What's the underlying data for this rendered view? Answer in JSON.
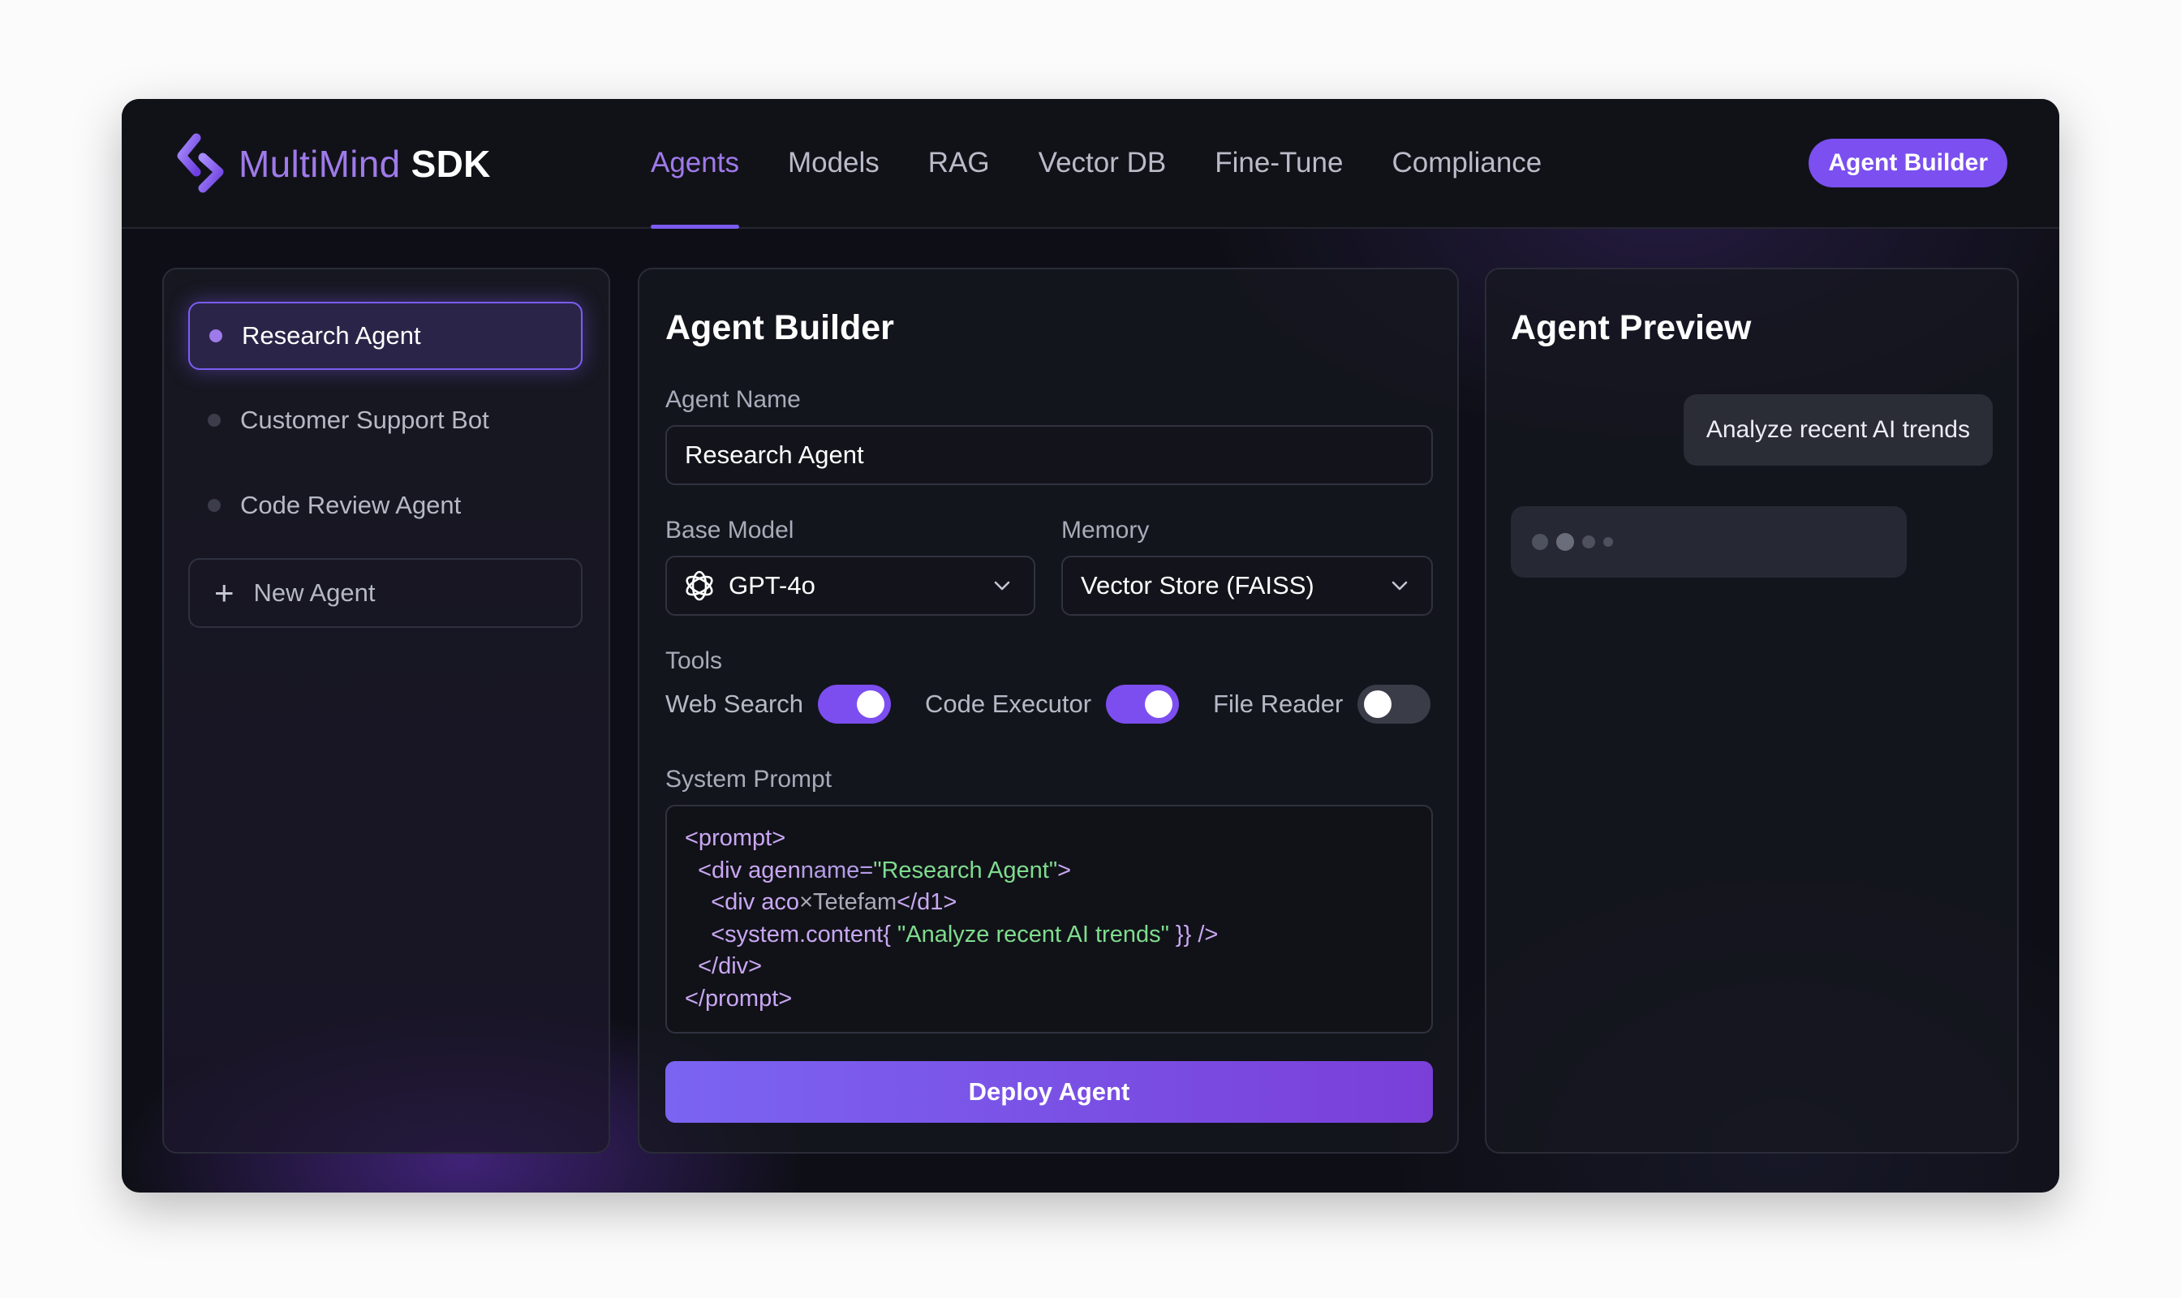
{
  "app": {
    "logo_primary": "MultiMind",
    "logo_secondary": "SDK",
    "accent_color": "#7c4ef0"
  },
  "nav": {
    "items": [
      {
        "label": "Agents",
        "active": true
      },
      {
        "label": "Models",
        "active": false
      },
      {
        "label": "RAG",
        "active": false
      },
      {
        "label": "Vector DB",
        "active": false
      },
      {
        "label": "Fine-Tune",
        "active": false
      },
      {
        "label": "Compliance",
        "active": false
      }
    ],
    "cta_label": "Agent Builder"
  },
  "sidebar": {
    "agents": [
      {
        "label": "Research Agent",
        "active": true
      },
      {
        "label": "Customer Support Bot",
        "active": false
      },
      {
        "label": "Code Review Agent",
        "active": false
      }
    ],
    "new_agent_label": "New Agent"
  },
  "builder": {
    "title": "Agent Builder",
    "agent_name_label": "Agent Name",
    "agent_name_value": "Research Agent",
    "base_model_label": "Base Model",
    "base_model_value": "GPT-4o",
    "base_model_icon": "openai-icon",
    "memory_label": "Memory",
    "memory_value": "Vector Store (FAISS)",
    "tools_label": "Tools",
    "tools": [
      {
        "label": "Web Search",
        "enabled": true
      },
      {
        "label": "Code Executor",
        "enabled": true
      },
      {
        "label": "File Reader",
        "enabled": false
      }
    ],
    "system_prompt_label": "System Prompt",
    "system_prompt_lines": {
      "l1": "<prompt>",
      "l2a": "  <div agen",
      "l2b": "name=",
      "l2c": "\"Research Agent\"",
      "l2d": ">",
      "l3a": "    <div aco",
      "l3b": "×Tetefam",
      "l3c": "</d1>",
      "l4a": "    <system.content{ ",
      "l4b": "\"Analyze recent AI trends\"",
      "l4c": " }} />",
      "l5": "  </div>",
      "l6": "</prompt>"
    },
    "deploy_label": "Deploy Agent"
  },
  "preview": {
    "title": "Agent Preview",
    "user_message": "Analyze recent AI trends"
  }
}
